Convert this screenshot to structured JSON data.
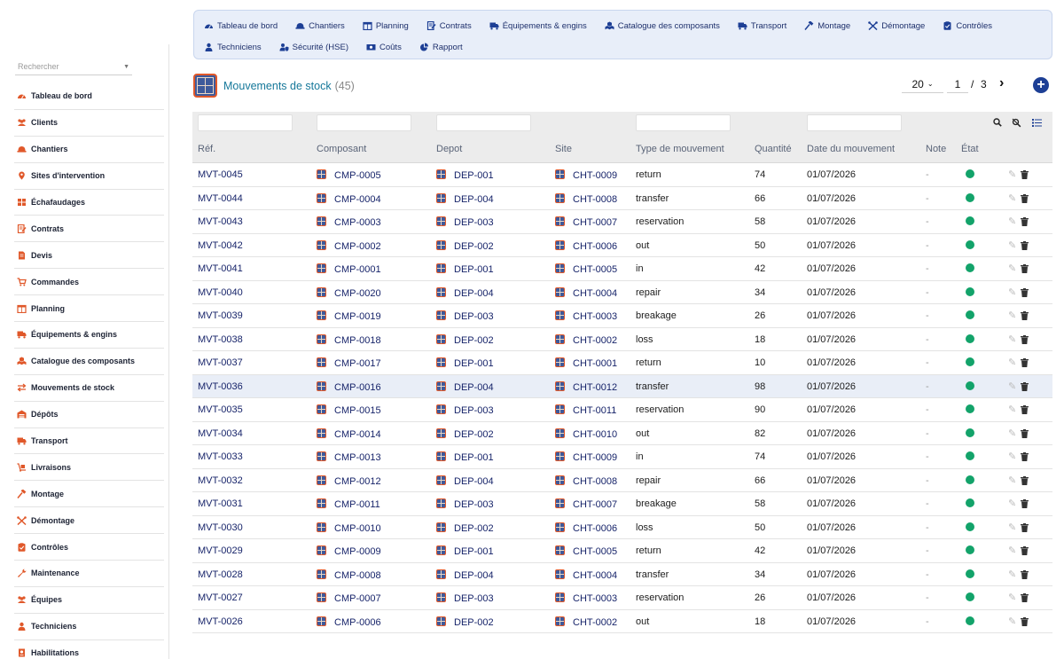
{
  "colors": {
    "accent": "#1d3f95",
    "brand_orange": "#e0582a",
    "status_ok": "#13a36a",
    "link": "#17246a"
  },
  "sidebar": {
    "search_placeholder": "Rechercher",
    "items": [
      {
        "label": "Tableau de bord",
        "icon": "dashboard-icon"
      },
      {
        "label": "Clients",
        "icon": "users-icon"
      },
      {
        "label": "Chantiers",
        "icon": "hard-hat-icon"
      },
      {
        "label": "Sites d'intervention",
        "icon": "map-marker-icon"
      },
      {
        "label": "Échafaudages",
        "icon": "grid-icon"
      },
      {
        "label": "Contrats",
        "icon": "contract-icon"
      },
      {
        "label": "Devis",
        "icon": "document-icon"
      },
      {
        "label": "Commandes",
        "icon": "cart-icon"
      },
      {
        "label": "Planning",
        "icon": "calendar-icon"
      },
      {
        "label": "Équipements & engins",
        "icon": "truck-icon"
      },
      {
        "label": "Catalogue des composants",
        "icon": "cubes-icon"
      },
      {
        "label": "Mouvements de stock",
        "icon": "exchange-icon"
      },
      {
        "label": "Dépôts",
        "icon": "warehouse-icon"
      },
      {
        "label": "Transport",
        "icon": "truck-icon"
      },
      {
        "label": "Livraisons",
        "icon": "dolly-icon"
      },
      {
        "label": "Montage",
        "icon": "hammer-icon"
      },
      {
        "label": "Démontage",
        "icon": "tools-icon"
      },
      {
        "label": "Contrôles",
        "icon": "clipboard-check-icon"
      },
      {
        "label": "Maintenance",
        "icon": "wrench-icon"
      },
      {
        "label": "Équipes",
        "icon": "team-icon"
      },
      {
        "label": "Techniciens",
        "icon": "technician-icon"
      },
      {
        "label": "Habilitations",
        "icon": "certificate-icon"
      }
    ]
  },
  "topnav": {
    "items": [
      {
        "label": "Tableau de bord",
        "icon": "dashboard-icon"
      },
      {
        "label": "Chantiers",
        "icon": "hard-hat-icon"
      },
      {
        "label": "Planning",
        "icon": "calendar-icon"
      },
      {
        "label": "Contrats",
        "icon": "contract-icon"
      },
      {
        "label": "Équipements & engins",
        "icon": "truck-icon"
      },
      {
        "label": "Catalogue des composants",
        "icon": "cubes-icon"
      },
      {
        "label": "Transport",
        "icon": "truck-icon"
      },
      {
        "label": "Montage",
        "icon": "hammer-icon"
      },
      {
        "label": "Démontage",
        "icon": "tools-icon"
      },
      {
        "label": "Contrôles",
        "icon": "clipboard-check-icon"
      },
      {
        "label": "Techniciens",
        "icon": "technician-icon"
      },
      {
        "label": "Sécurité (HSE)",
        "icon": "user-shield-icon"
      },
      {
        "label": "Coûts",
        "icon": "money-icon"
      },
      {
        "label": "Rapport",
        "icon": "pie-chart-icon"
      }
    ]
  },
  "page": {
    "title": "Mouvements de stock",
    "count": "(45)",
    "page_size": "20",
    "current_page": "1",
    "separator": "/",
    "total_pages": "3",
    "next_icon": "chevron-right-icon",
    "add_icon": "plus-circle-icon"
  },
  "table": {
    "columns": [
      "Réf.",
      "Composant",
      "Depot",
      "Site",
      "Type de mouvement",
      "Quantité",
      "Date du mouvement",
      "Note",
      "État"
    ],
    "tools": [
      "search-icon",
      "clear-filter-icon",
      "list-icon"
    ],
    "highlighted_row": 9,
    "rows": [
      {
        "ref": "MVT-0045",
        "composant": "CMP-0005",
        "depot": "DEP-001",
        "site": "CHT-0009",
        "type": "return",
        "qty": "74",
        "date": "01/07/2026",
        "note": "-"
      },
      {
        "ref": "MVT-0044",
        "composant": "CMP-0004",
        "depot": "DEP-004",
        "site": "CHT-0008",
        "type": "transfer",
        "qty": "66",
        "date": "01/07/2026",
        "note": "-"
      },
      {
        "ref": "MVT-0043",
        "composant": "CMP-0003",
        "depot": "DEP-003",
        "site": "CHT-0007",
        "type": "reservation",
        "qty": "58",
        "date": "01/07/2026",
        "note": "-"
      },
      {
        "ref": "MVT-0042",
        "composant": "CMP-0002",
        "depot": "DEP-002",
        "site": "CHT-0006",
        "type": "out",
        "qty": "50",
        "date": "01/07/2026",
        "note": "-"
      },
      {
        "ref": "MVT-0041",
        "composant": "CMP-0001",
        "depot": "DEP-001",
        "site": "CHT-0005",
        "type": "in",
        "qty": "42",
        "date": "01/07/2026",
        "note": "-"
      },
      {
        "ref": "MVT-0040",
        "composant": "CMP-0020",
        "depot": "DEP-004",
        "site": "CHT-0004",
        "type": "repair",
        "qty": "34",
        "date": "01/07/2026",
        "note": "-"
      },
      {
        "ref": "MVT-0039",
        "composant": "CMP-0019",
        "depot": "DEP-003",
        "site": "CHT-0003",
        "type": "breakage",
        "qty": "26",
        "date": "01/07/2026",
        "note": "-"
      },
      {
        "ref": "MVT-0038",
        "composant": "CMP-0018",
        "depot": "DEP-002",
        "site": "CHT-0002",
        "type": "loss",
        "qty": "18",
        "date": "01/07/2026",
        "note": "-"
      },
      {
        "ref": "MVT-0037",
        "composant": "CMP-0017",
        "depot": "DEP-001",
        "site": "CHT-0001",
        "type": "return",
        "qty": "10",
        "date": "01/07/2026",
        "note": "-"
      },
      {
        "ref": "MVT-0036",
        "composant": "CMP-0016",
        "depot": "DEP-004",
        "site": "CHT-0012",
        "type": "transfer",
        "qty": "98",
        "date": "01/07/2026",
        "note": "-"
      },
      {
        "ref": "MVT-0035",
        "composant": "CMP-0015",
        "depot": "DEP-003",
        "site": "CHT-0011",
        "type": "reservation",
        "qty": "90",
        "date": "01/07/2026",
        "note": "-"
      },
      {
        "ref": "MVT-0034",
        "composant": "CMP-0014",
        "depot": "DEP-002",
        "site": "CHT-0010",
        "type": "out",
        "qty": "82",
        "date": "01/07/2026",
        "note": "-"
      },
      {
        "ref": "MVT-0033",
        "composant": "CMP-0013",
        "depot": "DEP-001",
        "site": "CHT-0009",
        "type": "in",
        "qty": "74",
        "date": "01/07/2026",
        "note": "-"
      },
      {
        "ref": "MVT-0032",
        "composant": "CMP-0012",
        "depot": "DEP-004",
        "site": "CHT-0008",
        "type": "repair",
        "qty": "66",
        "date": "01/07/2026",
        "note": "-"
      },
      {
        "ref": "MVT-0031",
        "composant": "CMP-0011",
        "depot": "DEP-003",
        "site": "CHT-0007",
        "type": "breakage",
        "qty": "58",
        "date": "01/07/2026",
        "note": "-"
      },
      {
        "ref": "MVT-0030",
        "composant": "CMP-0010",
        "depot": "DEP-002",
        "site": "CHT-0006",
        "type": "loss",
        "qty": "50",
        "date": "01/07/2026",
        "note": "-"
      },
      {
        "ref": "MVT-0029",
        "composant": "CMP-0009",
        "depot": "DEP-001",
        "site": "CHT-0005",
        "type": "return",
        "qty": "42",
        "date": "01/07/2026",
        "note": "-"
      },
      {
        "ref": "MVT-0028",
        "composant": "CMP-0008",
        "depot": "DEP-004",
        "site": "CHT-0004",
        "type": "transfer",
        "qty": "34",
        "date": "01/07/2026",
        "note": "-"
      },
      {
        "ref": "MVT-0027",
        "composant": "CMP-0007",
        "depot": "DEP-003",
        "site": "CHT-0003",
        "type": "reservation",
        "qty": "26",
        "date": "01/07/2026",
        "note": "-"
      },
      {
        "ref": "MVT-0026",
        "composant": "CMP-0006",
        "depot": "DEP-002",
        "site": "CHT-0002",
        "type": "out",
        "qty": "18",
        "date": "01/07/2026",
        "note": "-"
      }
    ]
  }
}
